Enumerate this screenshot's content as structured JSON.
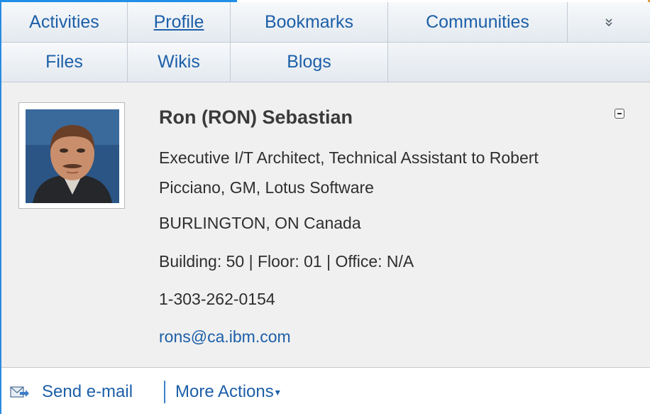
{
  "tabs": {
    "row1": [
      {
        "label": "Activities",
        "active": false
      },
      {
        "label": "Profile",
        "active": true
      },
      {
        "label": "Bookmarks",
        "active": false
      },
      {
        "label": "Communities",
        "active": false
      }
    ],
    "more_icon": "double-chevron-down-icon",
    "more_glyph": "»",
    "row2": [
      {
        "label": "Files"
      },
      {
        "label": "Wikis"
      },
      {
        "label": "Blogs"
      }
    ]
  },
  "profile": {
    "name": "Ron (RON) Sebastian",
    "title_line1": "Executive I/T Architect, Technical Assistant to Robert",
    "title_line2": "Picciano, GM, Lotus Software",
    "location": "BURLINGTON, ON Canada",
    "building": "Building: 50 | Floor: 01 | Office: N/A",
    "phone": "1-303-262-0154",
    "email": "rons@ca.ibm.com"
  },
  "footer": {
    "send_email_label": "Send e-mail",
    "more_actions_label": "More Actions",
    "caret": "▾"
  },
  "colors": {
    "link": "#1c5fa8",
    "tab_bg": "#e3e9ef",
    "card_bg": "#f0f0f0"
  }
}
